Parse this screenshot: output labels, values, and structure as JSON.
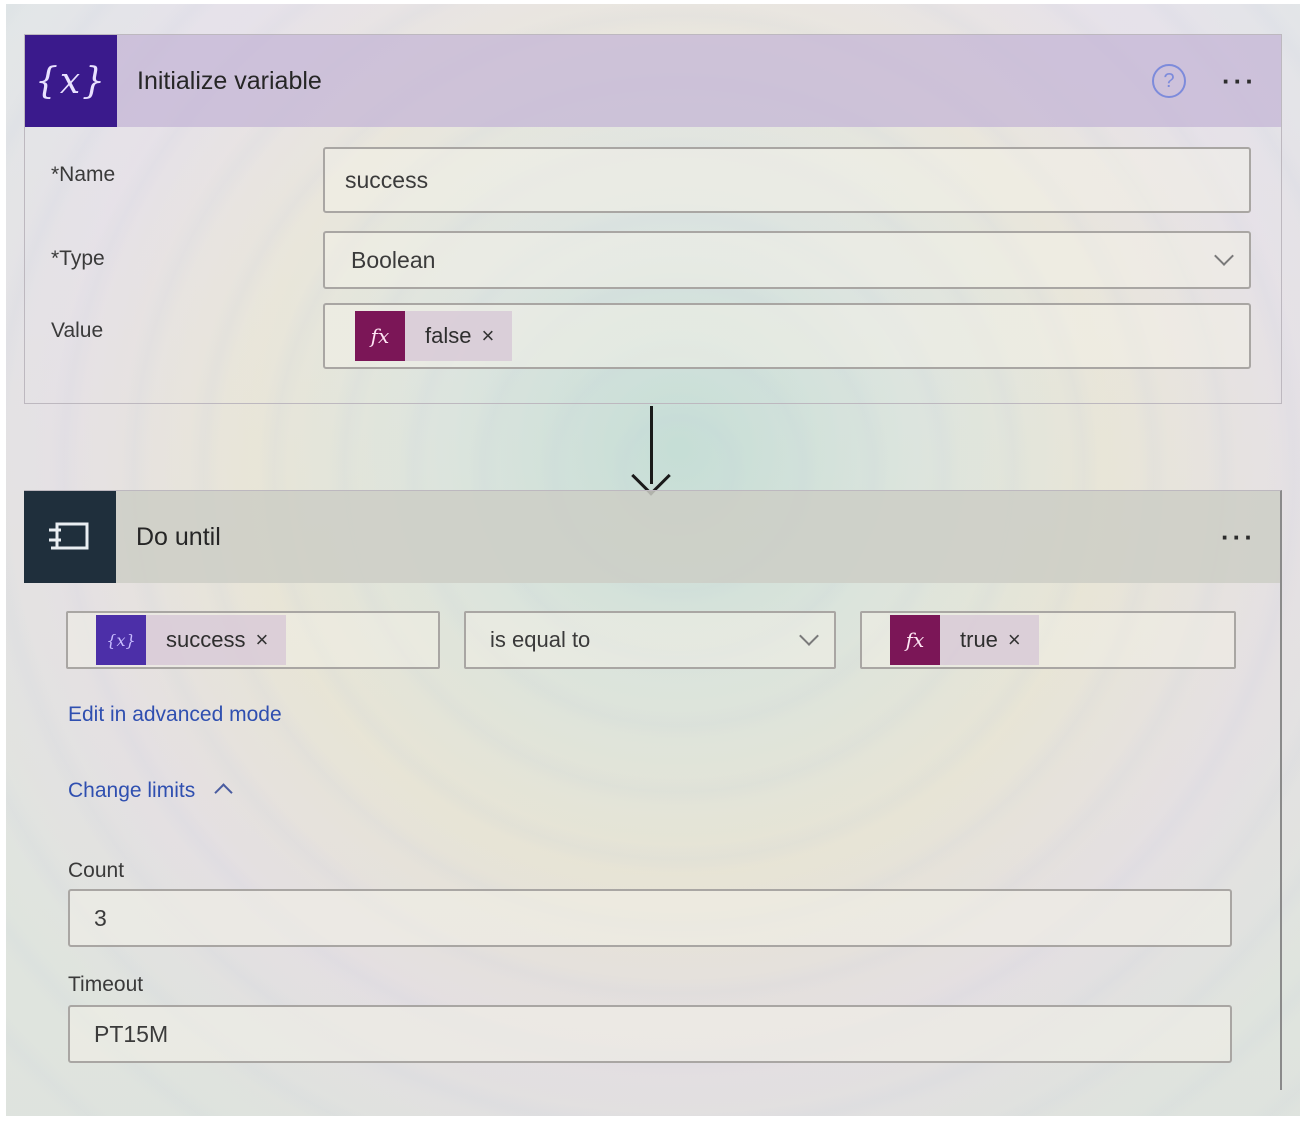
{
  "init_variable": {
    "title": "Initialize variable",
    "icon": "{x}",
    "help_icon": "?",
    "more_icon": "···",
    "fields": {
      "name_label": "*Name",
      "name_value": "success",
      "type_label": "*Type",
      "type_value": "Boolean",
      "value_label": "Value",
      "value_token": {
        "icon": "fx",
        "text": "false",
        "remove": "×"
      }
    }
  },
  "do_until": {
    "title": "Do until",
    "more_icon": "···",
    "condition": {
      "left_token": {
        "icon": "{x}",
        "text": "success",
        "remove": "×"
      },
      "operator": "is equal to",
      "right_token": {
        "icon": "fx",
        "text": "true",
        "remove": "×"
      }
    },
    "advanced_mode_link": "Edit in advanced mode",
    "change_limits_link": "Change limits",
    "count_label": "Count",
    "count_value": "3",
    "timeout_label": "Timeout",
    "timeout_value": "PT15M"
  },
  "colors": {
    "variable_icon_bg": "#3a1a8c",
    "loop_icon_bg": "#1f2f3c",
    "expression_token_bg": "#7b1657",
    "link": "#2f4fb0"
  }
}
